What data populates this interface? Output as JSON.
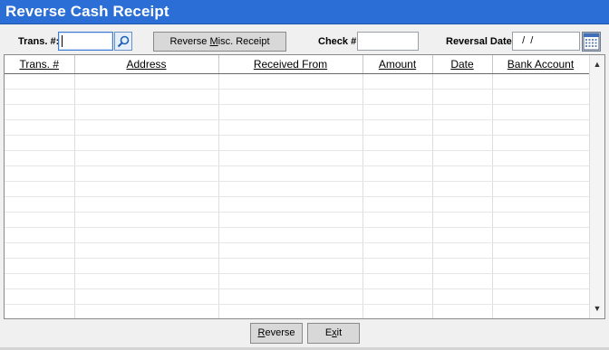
{
  "window": {
    "title": "Reverse Cash Receipt"
  },
  "filters": {
    "trans_label": "Trans. #:",
    "trans_value": "",
    "reverse_misc_label_pre": "Reverse ",
    "reverse_misc_label_ul": "M",
    "reverse_misc_label_post": "isc. Receipt",
    "check_label": "Check #:",
    "check_value": "",
    "reversal_date_label": "Reversal Date:",
    "reversal_date_value": "  /  /"
  },
  "grid": {
    "columns": [
      "Trans. #",
      "Address",
      "Received From",
      "Amount",
      "Date",
      "Bank Account"
    ],
    "rows": []
  },
  "footer": {
    "reverse_ul": "R",
    "reverse_rest": "everse",
    "exit_pre": "E",
    "exit_ul": "x",
    "exit_post": "it"
  }
}
